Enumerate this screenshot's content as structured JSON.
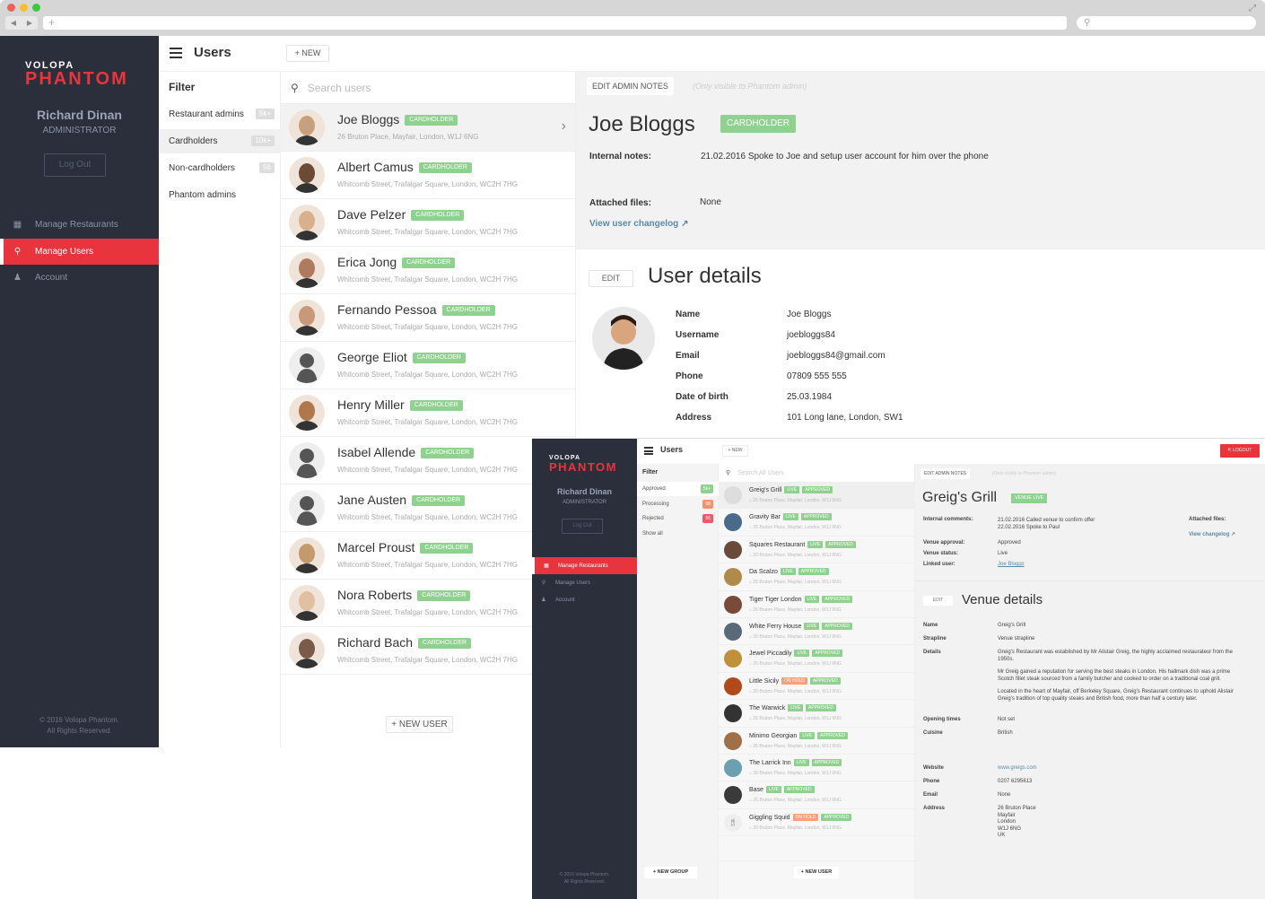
{
  "browser": {
    "url": "",
    "new_tab_icon": "+",
    "back_icon": "◀",
    "forward_icon": "▶",
    "expand_icon": "⤢"
  },
  "app": {
    "logo_top": "VOLOPA",
    "logo_bottom": "PHANTOM",
    "user_name": "Richard Dinan",
    "user_role": "ADMINISTRATOR",
    "logout_label": "Log Out",
    "nav": [
      {
        "label": "Manage Restaurants",
        "icon": "grid-icon",
        "glyph": "▦"
      },
      {
        "label": "Manage Users",
        "icon": "search-icon",
        "glyph": "🔍︎",
        "active": true
      },
      {
        "label": "Account",
        "icon": "user-icon",
        "glyph": "♟"
      }
    ],
    "footer_line1": "© 2016 Volopa Phantom.",
    "footer_line2": "All Rights Reserved.",
    "page_title": "Users",
    "new_label": "+ NEW",
    "filter": {
      "title": "Filter",
      "items": [
        {
          "label": "Restaurant admins",
          "badge": "5k+"
        },
        {
          "label": "Cardholders",
          "badge": "10k+",
          "selected": true
        },
        {
          "label": "Non-cardholders",
          "badge": "56"
        },
        {
          "label": "Phantom admins",
          "badge": ""
        }
      ]
    },
    "search_placeholder": "Search users",
    "users": [
      {
        "name": "Joe Bloggs",
        "tag": "CARDHOLDER",
        "address": "26 Bruton Place, Mayfair, London, W1J 6NG",
        "selected": true
      },
      {
        "name": "Albert Camus",
        "tag": "CARDHOLDER",
        "address": "Whitcomb Street, Trafalgar Square, London, WC2H 7HG"
      },
      {
        "name": "Dave Pelzer",
        "tag": "CARDHOLDER",
        "address": "Whitcomb Street, Trafalgar Square, London, WC2H 7HG"
      },
      {
        "name": "Erica Jong",
        "tag": "CARDHOLDER",
        "address": "Whitcomb Street, Trafalgar Square, London, WC2H 7HG"
      },
      {
        "name": "Fernando Pessoa",
        "tag": "CARDHOLDER",
        "address": "Whitcomb Street, Trafalgar Square, London, WC2H 7HG"
      },
      {
        "name": "George Eliot",
        "tag": "CARDHOLDER",
        "address": "Whitcomb Street, Trafalgar Square, London, WC2H 7HG"
      },
      {
        "name": "Henry Miller",
        "tag": "CARDHOLDER",
        "address": "Whitcomb Street, Trafalgar Square, London, WC2H 7HG"
      },
      {
        "name": "Isabel Allende",
        "tag": "CARDHOLDER",
        "address": "Whitcomb Street, Trafalgar Square, London, WC2H 7HG"
      },
      {
        "name": "Jane Austen",
        "tag": "CARDHOLDER",
        "address": "Whitcomb Street, Trafalgar Square, London, WC2H 7HG"
      },
      {
        "name": "Marcel Proust",
        "tag": "CARDHOLDER",
        "address": "Whitcomb Street, Trafalgar Square, London, WC2H 7HG"
      },
      {
        "name": "Nora Roberts",
        "tag": "CARDHOLDER",
        "address": "Whitcomb Street, Trafalgar Square, London, WC2H 7HG"
      },
      {
        "name": "Richard Bach",
        "tag": "CARDHOLDER",
        "address": "Whitcomb Street, Trafalgar Square, London, WC2H 7HG"
      }
    ],
    "new_user_label": "+ NEW USER",
    "detail": {
      "edit_notes_label": "EDIT ADMIN NOTES",
      "visibility_note": "(Only visible to Phantom admin)",
      "name": "Joe Bloggs",
      "tag": "CARDHOLDER",
      "internal_notes_label": "Internal notes:",
      "internal_notes": "21.02.2016 Spoke to Joe and setup user account for him over the phone",
      "attached_label": "Attached files:",
      "attached": "None",
      "changelog_label": "View user changelog",
      "edit_label": "EDIT",
      "section_title": "User details",
      "fields": [
        {
          "label": "Name",
          "value": "Joe Bloggs"
        },
        {
          "label": "Username",
          "value": "joebloggs84"
        },
        {
          "label": "Email",
          "value": "joebloggs84@gmail.com"
        },
        {
          "label": "Phone",
          "value": "07809 555 555"
        },
        {
          "label": "Date of birth",
          "value": "25.03.1984"
        },
        {
          "label": "Address",
          "value": "101 Long lane, London, SW1"
        }
      ]
    }
  },
  "app2": {
    "logo_top": "VOLOPA",
    "logo_bottom": "PHANTOM",
    "user_name": "Richard Dinan",
    "user_role": "ADMINISTRATOR",
    "logout_label": "Log Out",
    "nav": [
      {
        "label": "Manage Restaurants",
        "glyph": "▦",
        "active": true
      },
      {
        "label": "Manage Users",
        "glyph": "🔍︎"
      },
      {
        "label": "Account",
        "glyph": "♟"
      }
    ],
    "footer_line1": "© 2016 Volopa Phantom.",
    "footer_line2": "All Rights Reserved.",
    "page_title": "Users",
    "new_label": "+ NEW",
    "top_logout_label": "LOGOUT",
    "filter": {
      "title": "Filter",
      "items": [
        {
          "label": "Approved",
          "badge": "5k+",
          "color": "#8fd18f",
          "selected": true
        },
        {
          "label": "Processing",
          "badge": "98",
          "color": "#f5926b"
        },
        {
          "label": "Rejected",
          "badge": "56",
          "color": "#f0596a"
        },
        {
          "label": "Show all",
          "badge": ""
        }
      ]
    },
    "search_placeholder": "Search All Users",
    "venues": [
      {
        "name": "Greig's Grill",
        "status": "LIVE",
        "approval": "APPROVED",
        "address": "26 Bruton Place, Mayfair, London, W1J 6NG"
      },
      {
        "name": "Gravity Bar",
        "status": "LIVE",
        "approval": "APPROVED",
        "address": "26 Bruton Place, Mayfair, London, W1J 6NG"
      },
      {
        "name": "Squares Restaurant",
        "status": "LIVE",
        "approval": "APPROVED",
        "address": "26 Bruton Place, Mayfair, London, W1J 6NG"
      },
      {
        "name": "Da Scalzo",
        "status": "LIVE",
        "approval": "APPROVED",
        "address": "26 Bruton Place, Mayfair, London, W1J 6NG"
      },
      {
        "name": "Tiger Tiger London",
        "status": "LIVE",
        "approval": "APPROVED",
        "address": "26 Bruton Place, Mayfair, London, W1J 6NG"
      },
      {
        "name": "White Ferry House",
        "status": "LIVE",
        "approval": "APPROVED",
        "address": "26 Bruton Place, Mayfair, London, W1J 6NG"
      },
      {
        "name": "Jewel Piccadily",
        "status": "LIVE",
        "approval": "APPROVED",
        "address": "26 Bruton Place, Mayfair, London, W1J 6NG"
      },
      {
        "name": "Little Sicily",
        "status": "ON HOLD",
        "approval": "APPROVED",
        "address": "26 Bruton Place, Mayfair, London, W1J 6NG"
      },
      {
        "name": "The Warwick",
        "status": "LIVE",
        "approval": "APPROVED",
        "address": "26 Bruton Place, Mayfair, London, W1J 6NG"
      },
      {
        "name": "Minimo Georgian",
        "status": "LIVE",
        "approval": "APPROVED",
        "address": "26 Bruton Place, Mayfair, London, W1J 6NG"
      },
      {
        "name": "The Larrick Inn",
        "status": "LIVE",
        "approval": "APPROVED",
        "address": "26 Bruton Place, Mayfair, London, W1J 6NG"
      },
      {
        "name": "Base",
        "status": "LIVE",
        "approval": "APPROVED",
        "address": "26 Bruton Place, Mayfair, London, W1J 6NG"
      },
      {
        "name": "Giggling Squid",
        "status": "ON HOLD",
        "approval": "APPROVED",
        "address": "26 Bruton Place, Mayfair, London, W1J 6NG"
      }
    ],
    "new_group_label": "+ NEW GROUP",
    "new_user_label": "+ NEW USER",
    "detail": {
      "edit_notes_label": "EDIT ADMIN NOTES",
      "visibility_note": "(Only visible to Phantom admin)",
      "name": "Greig's Grill",
      "tag": "VENUE LIVE",
      "internal_label": "Internal comments:",
      "internal_line1": "21.02.2016 Called venue to confirm offer",
      "internal_line2": "22.02.2016 Spoke to Paul",
      "attached_label": "Attached files:",
      "changelog_label": "View changelog",
      "approval_label": "Venue approval:",
      "approval": "Approved",
      "status_label": "Venue status:",
      "status": "Live",
      "linked_label": "Linked user:",
      "linked": "Joe Bloggs",
      "edit_label": "EDIT",
      "section_title": "Venue details",
      "name_label": "Name",
      "name_value": "Greig's Grill",
      "strapline_label": "Strapline",
      "strapline_value": "Venue strapline",
      "details_label": "Details",
      "details_p1": "Greig's Restaurant was established by Mr Alistair Greig, the highly acclaimed restaurateur from the 1950s.",
      "details_p2": "Mr Greig gained a reputation for serving the best steaks in London. His hallmark dish was a prime Scotch fillet steak sourced from a family butcher and cooked to order on a traditional coal grill.",
      "details_p3": "Located in the heart of Mayfair, off Berkeley Square, Greig's Restaurant continues to uphold Alistair Greig's tradition of top quality steaks and British food, more than half a century later.",
      "opening_label": "Opening times",
      "opening_value": "Not set",
      "cuisine_label": "Cuisine",
      "cuisine_value": "British",
      "website_label": "Website",
      "website_value": "www.greigs.com",
      "phone_label": "Phone",
      "phone_value": "0207 6295613",
      "email_label": "Email",
      "email_value": "None",
      "address_label": "Address",
      "address_lines": [
        "26 Bruton Place",
        "Mayfair",
        "London",
        "W1J 6NG",
        "UK"
      ]
    }
  },
  "colors": {
    "accent": "#e8353d",
    "sidebar": "#2b2f3c",
    "tag_green": "#8fd18f",
    "tag_orange": "#f5a07a",
    "link": "#5a8aa8"
  }
}
